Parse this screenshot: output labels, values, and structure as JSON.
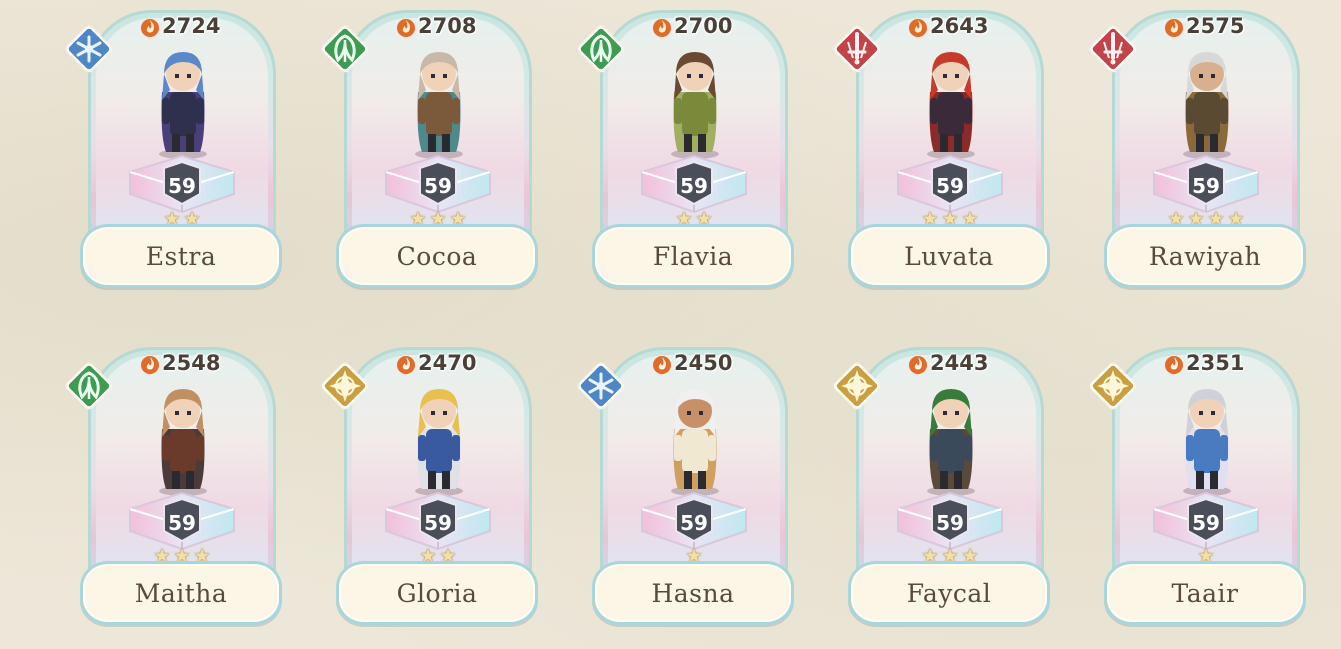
{
  "heroes": [
    {
      "name": "Estra",
      "power": "2724",
      "level": "59",
      "stars": 2,
      "element": "water",
      "element_icon": "snowflake-icon",
      "element_color": "#4f86c6"
    },
    {
      "name": "Cocoa",
      "power": "2708",
      "level": "59",
      "stars": 3,
      "element": "nature",
      "element_icon": "leaf-icon",
      "element_color": "#3f9a52"
    },
    {
      "name": "Flavia",
      "power": "2700",
      "level": "59",
      "stars": 2,
      "element": "nature",
      "element_icon": "leaf-icon",
      "element_color": "#3f9a52"
    },
    {
      "name": "Luvata",
      "power": "2643",
      "level": "59",
      "stars": 3,
      "element": "fire",
      "element_icon": "sword-icon",
      "element_color": "#c0444a"
    },
    {
      "name": "Rawiyah",
      "power": "2575",
      "level": "59",
      "stars": 4,
      "element": "fire",
      "element_icon": "sword-icon",
      "element_color": "#c0444a"
    },
    {
      "name": "Maitha",
      "power": "2548",
      "level": "59",
      "stars": 3,
      "element": "nature",
      "element_icon": "leaf-icon",
      "element_color": "#3f9a52"
    },
    {
      "name": "Gloria",
      "power": "2470",
      "level": "59",
      "stars": 2,
      "element": "light",
      "element_icon": "compass-star-icon",
      "element_color": "#c9a040"
    },
    {
      "name": "Hasna",
      "power": "2450",
      "level": "59",
      "stars": 1,
      "element": "water",
      "element_icon": "snowflake-icon",
      "element_color": "#4f86c6"
    },
    {
      "name": "Faycal",
      "power": "2443",
      "level": "59",
      "stars": 3,
      "element": "light",
      "element_icon": "compass-star-icon",
      "element_color": "#c9a040"
    },
    {
      "name": "Taair",
      "power": "2351",
      "level": "59",
      "stars": 1,
      "element": "light",
      "element_icon": "compass-star-icon",
      "element_color": "#c9a040"
    }
  ],
  "colors": {
    "power_flame": "#e46a2a",
    "level_shield": "#4a4d5a",
    "nameplate_border": "#a7d7dd",
    "name_text": "#5a4a3a"
  }
}
